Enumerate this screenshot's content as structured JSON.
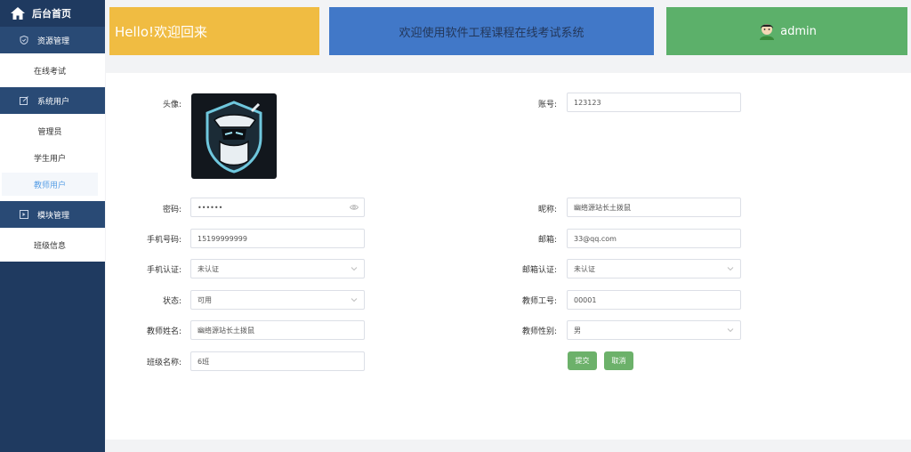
{
  "sidebar": {
    "home_label": "后台首页",
    "groups": [
      {
        "label": "资源管理",
        "icon": "shield-icon",
        "items": [
          {
            "label": "在线考试"
          }
        ]
      },
      {
        "label": "系统用户",
        "icon": "edit-icon",
        "items": [
          {
            "label": "管理员"
          },
          {
            "label": "学生用户"
          },
          {
            "label": "教师用户"
          }
        ]
      },
      {
        "label": "模块管理",
        "icon": "module-icon",
        "items": [
          {
            "label": "班级信息"
          }
        ]
      }
    ],
    "active_item": "教师用户"
  },
  "header": {
    "hello": "Hello!欢迎回来",
    "welcome": "欢迎使用软件工程课程在线考试系统",
    "username": "admin"
  },
  "form": {
    "avatar_label": "头像:",
    "account_label": "账号:",
    "account_value": "123123",
    "password_label": "密码:",
    "password_value": "••••••",
    "nickname_label": "昵称:",
    "nickname_value": "幽络源站长土拨鼠",
    "phone_label": "手机号码:",
    "phone_value": "15199999999",
    "email_label": "邮箱:",
    "email_value": "33@qq.com",
    "phone_verify_label": "手机认证:",
    "phone_verify_value": "未认证",
    "email_verify_label": "邮箱认证:",
    "email_verify_value": "未认证",
    "status_label": "状态:",
    "status_value": "可用",
    "teacher_id_label": "教师工号:",
    "teacher_id_value": "00001",
    "teacher_name_label": "教师姓名:",
    "teacher_name_value": "幽络源站长土拨鼠",
    "teacher_gender_label": "教师性别:",
    "teacher_gender_value": "男",
    "class_label": "班级名称:",
    "class_value": "6班",
    "submit_label": "提交",
    "cancel_label": "取消"
  },
  "colors": {
    "sidebar_bg": "#1f3a60",
    "hello_bg": "#f0bc42",
    "welcome_bg": "#4178c8",
    "user_bg": "#5cb06a",
    "button_bg": "#6cb16a",
    "active_text": "#5aa0e6"
  }
}
